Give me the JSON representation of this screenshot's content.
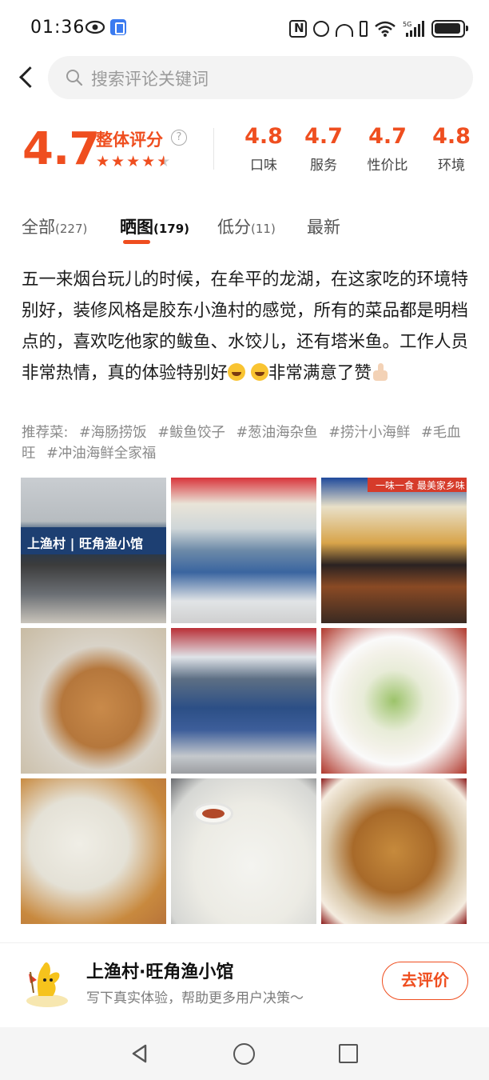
{
  "status_bar": {
    "time": "01:36",
    "icons": [
      "eye-icon",
      "app-badge-icon",
      "nfc-icon",
      "alarm-icon",
      "headset-icon",
      "battery-saver-icon",
      "wifi-icon",
      "signal-5g-icon",
      "battery-icon"
    ]
  },
  "header": {
    "back_icon": "chevron-left-icon",
    "search_placeholder": "搜索评论关键词"
  },
  "rating": {
    "overall": "4.7",
    "overall_label": "整体评分",
    "stars": 4.5,
    "sub_scores": [
      {
        "value": "4.8",
        "label": "口味"
      },
      {
        "value": "4.7",
        "label": "服务"
      },
      {
        "value": "4.7",
        "label": "性价比"
      },
      {
        "value": "4.8",
        "label": "环境"
      }
    ]
  },
  "tabs": [
    {
      "label": "全部",
      "count": "(227)",
      "active": false
    },
    {
      "label": "晒图",
      "count": "(179)",
      "active": true
    },
    {
      "label": "低分",
      "count": "(11)",
      "active": false
    },
    {
      "label": "最新",
      "count": "",
      "active": false
    }
  ],
  "review": {
    "text_main": "五一来烟台玩儿的时候，在牟平的龙湖，在这家吃的环境特别好，装修风格是胶东小渔村的感觉，所有的菜品都是明档点的，喜欢吃他家的鲅鱼、水饺儿，还有塔米鱼。工作人员非常热情，真的体验特别好",
    "text_end": "非常满意了赞",
    "recommend_label": "推荐菜:",
    "recommend_dishes": [
      "#海肠捞饭",
      "#鲅鱼饺子",
      "#葱油海杂鱼",
      "#捞汁小海鲜",
      "#毛血旺",
      "#冲油海鲜全家福"
    ]
  },
  "photos": {
    "shop_sign": "上渔村 | 旺角渔小馆",
    "menu_banner": "一味一食 最美家乡味",
    "items": [
      "storefront",
      "seafood-display",
      "menu-dishes",
      "skewers",
      "seafood-market",
      "stir-fried-squid",
      "dumpling-closeup",
      "dumplings-plate",
      "braised-fish"
    ]
  },
  "shop_bar": {
    "name": "上渔村·旺角渔小馆",
    "subtitle": "写下真实体验，帮助更多用户决策～",
    "button": "去评价"
  },
  "colors": {
    "accent": "#ef4e1f",
    "text": "#1b1b1b",
    "muted": "#8a8a8a"
  }
}
